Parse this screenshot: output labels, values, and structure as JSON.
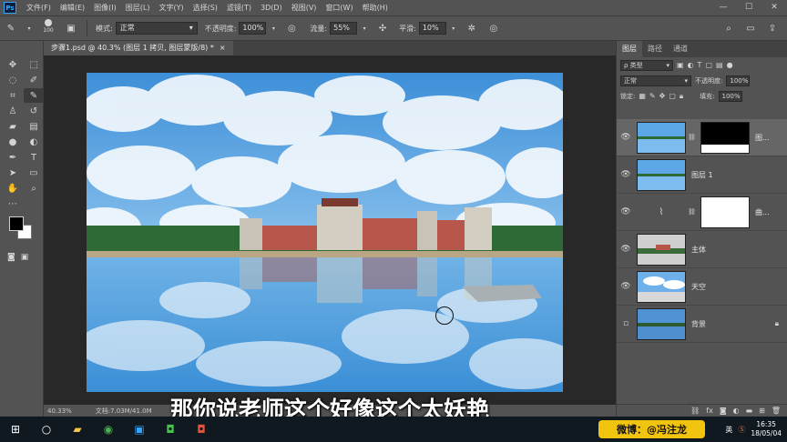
{
  "menubar": {
    "app_icon": "Ps",
    "items": [
      "文件(F)",
      "编辑(E)",
      "图像(I)",
      "图层(L)",
      "文字(Y)",
      "选择(S)",
      "滤镜(T)",
      "3D(D)",
      "视图(V)",
      "窗口(W)",
      "帮助(H)"
    ],
    "window_controls": [
      "—",
      "☐",
      "✕"
    ]
  },
  "options": {
    "brush_size": "100",
    "mode_label": "模式:",
    "mode_value": "正常",
    "opacity_label": "不透明度:",
    "opacity_value": "100%",
    "flow_label": "流量:",
    "flow_value": "55%",
    "smooth_label": "平滑:",
    "smooth_value": "10%"
  },
  "document_tab": {
    "title": "步骤1.psd @ 40.3% (图层 1 拷贝, 图层蒙版/8) *",
    "close": "×"
  },
  "status": {
    "zoom": "40.33%",
    "doc_size": "文档:7.03M/41.0M",
    "arrow": "›"
  },
  "subtitle": "那你说老师这个好像这个太妖艳",
  "panel": {
    "tabs": [
      "图层",
      "路径",
      "通道"
    ],
    "kind_label": "ρ 类型",
    "blend_mode": "正常",
    "opacity_label": "不透明度:",
    "opacity_value": "100%",
    "lock_label": "锁定:",
    "fill_label": "填充:",
    "fill_value": "100%"
  },
  "layers": [
    {
      "name": "图...",
      "selected": true,
      "visible": true
    },
    {
      "name": "图层 1",
      "selected": false,
      "visible": true
    },
    {
      "name": "曲...",
      "selected": false,
      "visible": true
    },
    {
      "name": "主体",
      "selected": false,
      "visible": true
    },
    {
      "name": "天空",
      "selected": false,
      "visible": true
    },
    {
      "name": "背景",
      "selected": false,
      "visible": false
    }
  ],
  "watermark": "微博：@冯注龙",
  "tray": {
    "lang": "英",
    "time": "16:35",
    "date": "18/05/04"
  },
  "colors": {
    "ui_bg": "#535353",
    "canvas_bg": "#282828",
    "accent": "#31a8ff",
    "taskbar": "#101820",
    "weibo": "#f1c40f"
  }
}
